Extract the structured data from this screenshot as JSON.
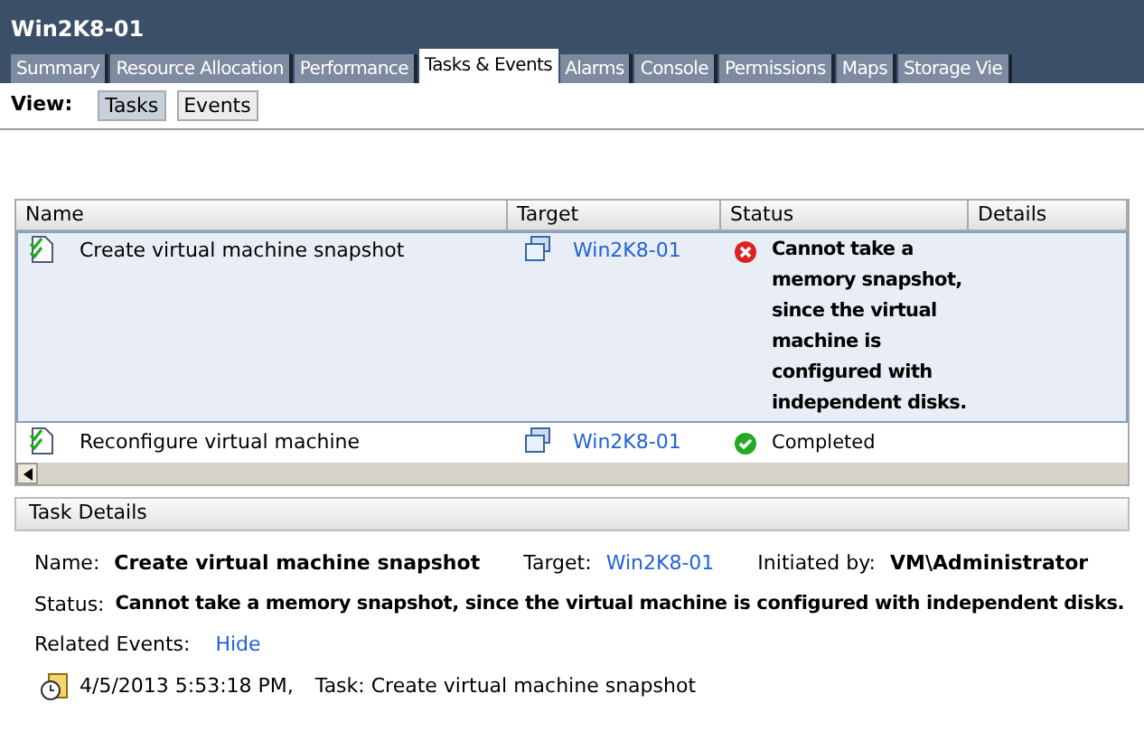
{
  "window": {
    "title": "Win2K8-01"
  },
  "tabs": [
    {
      "label": "Summary",
      "selected": false
    },
    {
      "label": "Resource Allocation",
      "selected": false
    },
    {
      "label": "Performance",
      "selected": false
    },
    {
      "label": "Tasks & Events",
      "selected": true
    },
    {
      "label": "Alarms",
      "selected": false
    },
    {
      "label": "Console",
      "selected": false
    },
    {
      "label": "Permissions",
      "selected": false
    },
    {
      "label": "Maps",
      "selected": false
    },
    {
      "label": "Storage Vie",
      "selected": false
    }
  ],
  "view": {
    "label": "View:",
    "options": [
      {
        "label": "Tasks",
        "selected": true
      },
      {
        "label": "Events",
        "selected": false
      }
    ]
  },
  "table": {
    "columns": [
      "Name",
      "Target",
      "Status",
      "Details"
    ],
    "rows": [
      {
        "name": "Create virtual machine snapshot",
        "target": "Win2K8-01",
        "status": "Cannot take a memory snapshot, since the virtual machine is configured with independent disks.",
        "kind": "error",
        "selected": true
      },
      {
        "name": "Reconfigure virtual machine",
        "target": "Win2K8-01",
        "status": "Completed",
        "kind": "success",
        "selected": false
      }
    ]
  },
  "task_details": {
    "title": "Task Details",
    "name_label": "Name:",
    "name": "Create virtual machine snapshot",
    "target_label": "Target:",
    "target": "Win2K8-01",
    "initiated_label": "Initiated by:",
    "initiated": "VM\\Administrator",
    "status_label": "Status:",
    "status": "Cannot take a memory snapshot, since the virtual machine is configured with independent disks.",
    "related_label": "Related Events:",
    "hide": "Hide",
    "events": [
      {
        "time": "4/5/2013 5:53:18 PM,",
        "text": "Task: Create virtual machine snapshot"
      }
    ]
  }
}
